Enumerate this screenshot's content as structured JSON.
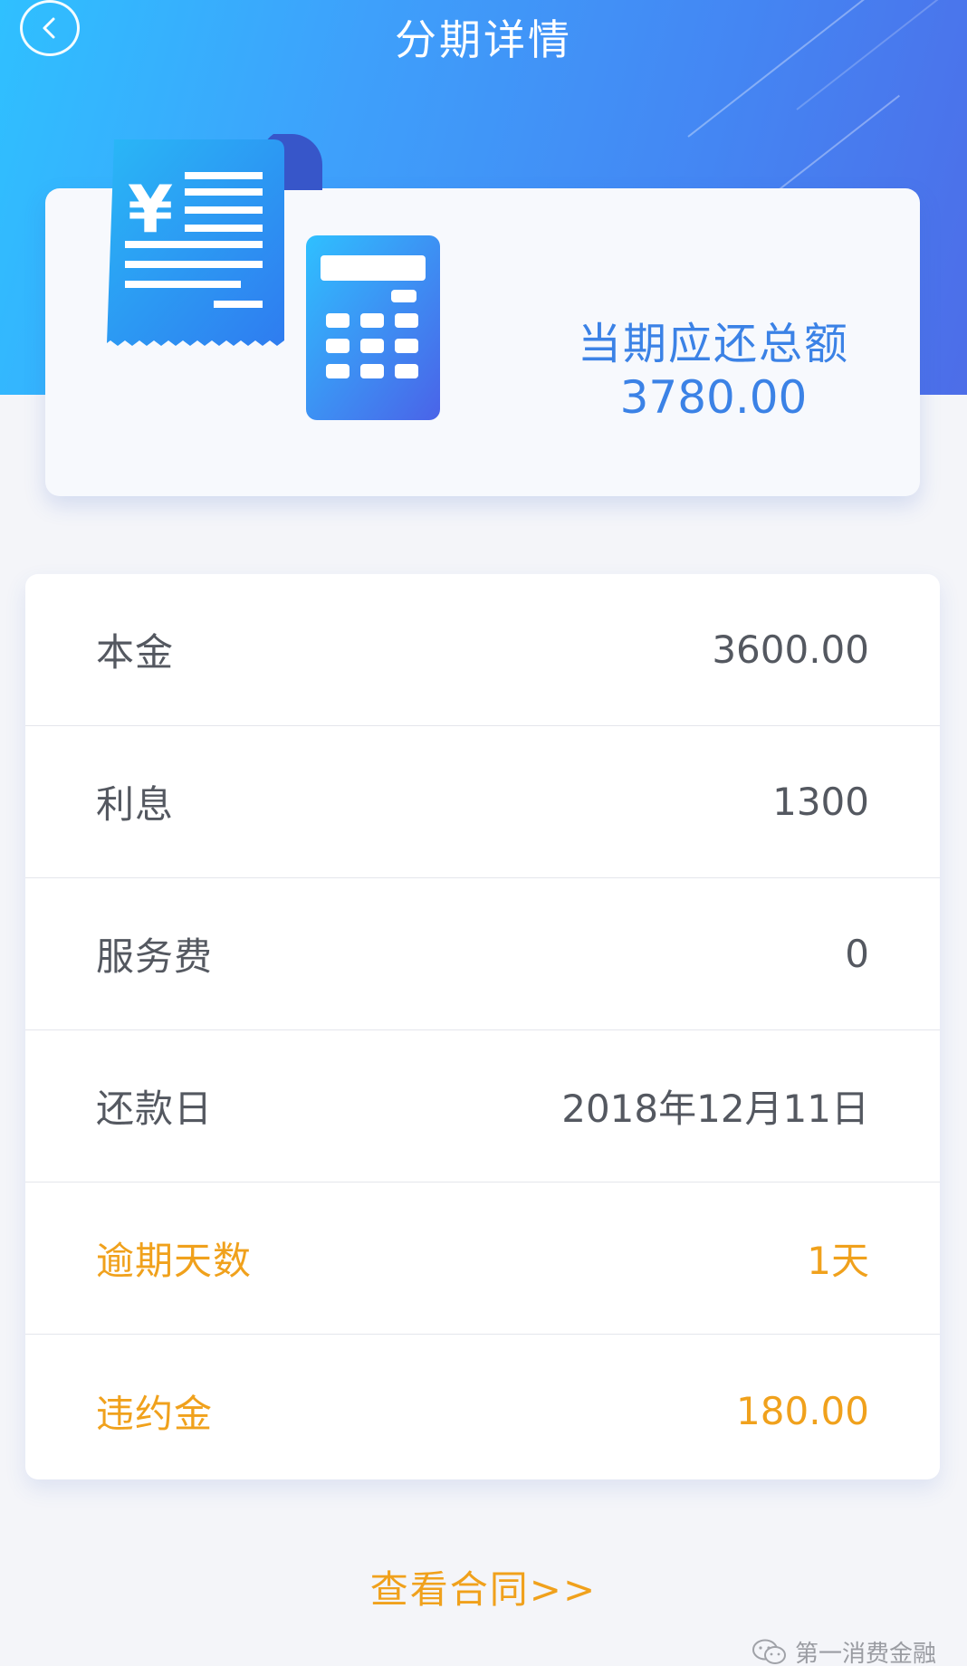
{
  "header": {
    "title": "分期详情",
    "back_icon": "chevron-left-icon"
  },
  "summary": {
    "label": "当期应还总额",
    "amount": "3780.00",
    "accent_color": "#3b82e6"
  },
  "details": {
    "rows": [
      {
        "label": "本金",
        "value": "3600.00"
      },
      {
        "label": "利息",
        "value": "1300"
      },
      {
        "label": "服务费",
        "value": "0"
      },
      {
        "label": "还款日",
        "value": "2018年12月11日"
      },
      {
        "label": "逾期天数",
        "value": "1天"
      },
      {
        "label": "违约金",
        "value": "180.00"
      }
    ],
    "warn_color": "#f0a11c"
  },
  "contract_link": "查看合同>>",
  "watermark": {
    "text": "第一消费金融",
    "icon": "wechat-icon"
  }
}
